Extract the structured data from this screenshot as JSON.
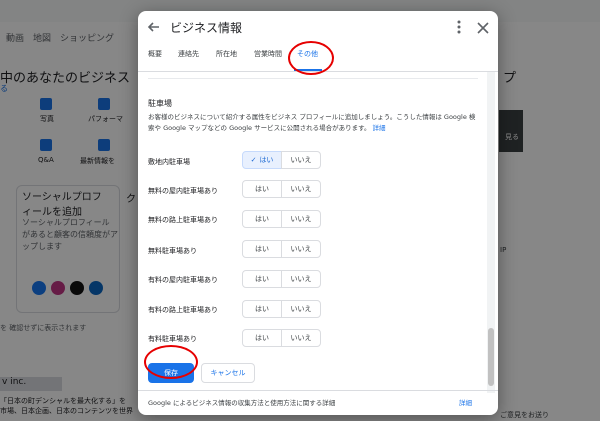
{
  "background": {
    "top_tabs": "動画　地図　ショッピング",
    "heading_left": "中のあなたのビジネス",
    "heading_right": "プ",
    "link_left": "る",
    "icons": [
      {
        "label": "写真"
      },
      {
        "label": "パフォーマ"
      },
      {
        "label": "Q&A"
      },
      {
        "label": "最新情報を"
      }
    ],
    "card": {
      "title_line1": "ソーシャルプロフ",
      "title_line2": "ィールを追加",
      "sub_line1": "ソーシャルプロフィール",
      "sub_line2": "があると顧客の信頼度がア",
      "sub_line3": "ップします"
    },
    "card2_letter": "ク",
    "note": "を 確認せずに表示されます",
    "chip": "v inc.",
    "foot1": "「日本の町デンシャルを最大化する」を",
    "foot2": "市場、日本企画、日本のコンテンツを世界",
    "side_label": "見る",
    "side_note": "IP",
    "side_foot": "ご意見をお送り"
  },
  "dialog": {
    "title": "ビジネス情報",
    "tabs": [
      {
        "label": "概要"
      },
      {
        "label": "連絡先"
      },
      {
        "label": "所在地"
      },
      {
        "label": "営業時間"
      },
      {
        "label": "その他"
      }
    ],
    "active_tab": "その他",
    "section_title": "駐車場",
    "section_desc": "お客様のビジネスについて紹介する属性をビジネス プロフィールに追加しましょう。こうした情報は Google 検索や Google マップなどの Google サービスに公開される場合があります。",
    "section_desc_link": "詳細",
    "rows": [
      {
        "label": "敷地内駐車場",
        "yes": "はい",
        "no": "いいえ",
        "selected": "yes"
      },
      {
        "label": "無料の屋内駐車場あり",
        "yes": "はい",
        "no": "いいえ",
        "selected": "none"
      },
      {
        "label": "無料の路上駐車場あり",
        "yes": "はい",
        "no": "いいえ",
        "selected": "none"
      },
      {
        "label": "無料駐車場あり",
        "yes": "はい",
        "no": "いいえ",
        "selected": "none"
      },
      {
        "label": "有料の屋内駐車場あり",
        "yes": "はい",
        "no": "いいえ",
        "selected": "none"
      },
      {
        "label": "有料の路上駐車場あり",
        "yes": "はい",
        "no": "いいえ",
        "selected": "none"
      },
      {
        "label": "有料駐車場あり",
        "yes": "はい",
        "no": "いいえ",
        "selected": "none"
      }
    ],
    "save_label": "保存",
    "cancel_label": "キャンセル",
    "footer_text": "Google によるビジネス情報の収集方法と使用方法に関する詳細",
    "footer_link": "詳細"
  },
  "colors": {
    "accent": "#1a73e8",
    "annotation_circle": "#e60000"
  }
}
